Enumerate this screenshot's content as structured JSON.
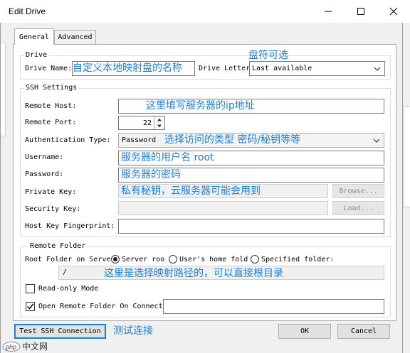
{
  "window": {
    "title": "Edit Drive",
    "minimize_icon": "minimize-icon",
    "maximize_icon": "maximize-icon",
    "close_icon": "close-icon"
  },
  "tabs": [
    {
      "label": "General",
      "active": true
    },
    {
      "label": "Advanced",
      "active": false
    }
  ],
  "drive": {
    "legend": "Drive",
    "name_label": "Drive Name:",
    "name_value": "",
    "letter_label": "Drive Letter",
    "letter_value": "Last available"
  },
  "ssh": {
    "legend": "SSH Settings",
    "host_label": "Remote Host:",
    "host_value": "",
    "port_label": "Remote Port:",
    "port_value": "22",
    "auth_label": "Authentication Type:",
    "auth_value": "Password",
    "username_label": "Username:",
    "username_value": "",
    "password_label": "Password:",
    "password_value": "",
    "private_key_label": "Private Key:",
    "private_key_value": "",
    "browse_label": "Browse...",
    "security_key_label": "Security Key:",
    "security_key_value": "",
    "load_label": "Load...",
    "fingerprint_label": "Host Key Fingerprint:",
    "fingerprint_value": ""
  },
  "remote": {
    "legend": "Remote Folder",
    "root_label": "Root Folder on Serve",
    "options": [
      {
        "label": "Server roo",
        "selected": true
      },
      {
        "label": "User's home fold",
        "selected": false
      },
      {
        "label": "Specified folder:",
        "selected": false
      }
    ],
    "folder_value": "/",
    "readonly_label": "Read-only Mode",
    "readonly_checked": false,
    "open_label": "Open Remote Folder On Connect:",
    "open_checked": true,
    "open_value": ""
  },
  "buttons": {
    "test": "Test SSH Connection",
    "ok": "OK",
    "cancel": "Cancel"
  },
  "annotations": {
    "drive_name": "自定义本地映射盘的名称",
    "drive_letter": "盘符可选",
    "host": "这里填写服务器的ip地址",
    "auth": "选择访问的类型  密码/秘钥等等",
    "username": "服务器的用户名  root",
    "password": "服务器的密码",
    "private_key": "私有秘钥，云服务器可能会用到",
    "root_folder": "这里是选择映射路径的，可以直接根目录",
    "test": "测试连接"
  },
  "watermark": "中文网",
  "accent_color": "#1c7ed6"
}
